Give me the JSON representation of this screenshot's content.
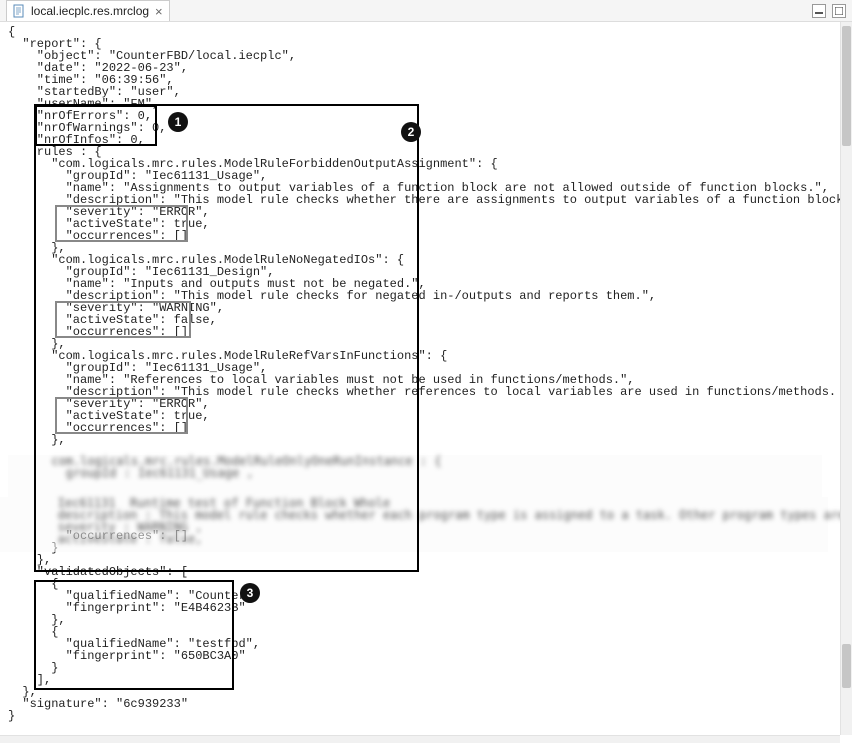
{
  "tab": {
    "title": "local.iecplc.res.mrclog",
    "close": "×"
  },
  "win": {
    "min": "▢",
    "max": "▣"
  },
  "callouts": {
    "c1": "1",
    "c2": "2",
    "c3": "3"
  },
  "report": {
    "open_brace": "{",
    "report_line": "  \"report\": {",
    "object_line": "    \"object\": \"CounterFBD/local.iecplc\",",
    "date_line": "    \"date\": \"2022-06-23\",",
    "time_line": "    \"time\": \"06:39:56\",",
    "startedBy_line": "    \"startedBy\": \"user\",",
    "userName_line": "    \"userName\": \"FM\",",
    "nrErrors": "    \"nrOfErrors\": 0,",
    "nrWarnings": "    \"nrOfWarnings\": 0,",
    "nrInfos": "    \"nrOfInfos\": 0,",
    "rules_open": "    rules : {",
    "rule1_key": "      \"com.logicals.mrc.rules.ModelRuleForbiddenOutputAssignment\": {",
    "rule1_groupId": "        \"groupId\": \"Iec61131_Usage\",",
    "rule1_name": "        \"name\": \"Assignments to output variables of a function block are not allowed outside of function blocks.\",",
    "rule1_desc": "        \"description\": \"This model rule checks whether there are assignments to output variables of a function block outside of function blocks.",
    "rule1_sev": "        \"severity\": \"ERROR\",",
    "rule1_active": "        \"activeState\": true,",
    "rule1_occ": "        \"occurrences\": []",
    "rule1_close": "      },",
    "rule2_key": "      \"com.logicals.mrc.rules.ModelRuleNoNegatedIOs\": {",
    "rule2_groupId": "        \"groupId\": \"Iec61131_Design\",",
    "rule2_name": "        \"name\": \"Inputs and outputs must not be negated.\",",
    "rule2_desc": "        \"description\": \"This model rule checks for negated in-/outputs and reports them.\",",
    "rule2_sev": "        \"severity\": \"WARNING\",",
    "rule2_active": "        \"activeState\": false,",
    "rule2_occ": "        \"occurrences\": []",
    "rule2_close": "      },",
    "rule3_key": "      \"com.logicals.mrc.rules.ModelRuleRefVarsInFunctions\": {",
    "rule3_groupId": "        \"groupId\": \"Iec61131_Usage\",",
    "rule3_name": "        \"name\": \"References to local variables must not be used in functions/methods.\",",
    "rule3_desc": "        \"description\": \"This model rule checks whether references to local variables are used in functions/methods. Such references to local var",
    "rule3_sev": "        \"severity\": \"ERROR\",",
    "rule3_active": "        \"activeState\": true,",
    "rule3_occ": "        \"occurrences\": []",
    "rule3_close": "      },",
    "blur1a": "      com.logicals.mrc.rules.ModelRuleOnlyOneRunInstance : {",
    "blur1b": "        groupId : Iec61131_Usage ,",
    "blank": "",
    "blur2a": "        Iec61131  Runtime test of Function Block Whole",
    "blur2b": "        description : This model rule checks whether each program type is assigned to a task. Other program types are reported.",
    "blur2c": "        severity : WARNING ,",
    "blur2d": "        activeState : false,",
    "rule4_occ": "        \"occurrences\": []",
    "rule4_close": "      }",
    "rules_close": "    },",
    "valObj_open": "    \"validatedObjects\": [",
    "obj1_open": "      {",
    "obj1_qname": "        \"qualifiedName\": \"Counter\",",
    "obj1_fprint": "        \"fingerprint\": \"E4B4623B\"",
    "obj1_close": "      },",
    "obj2_open": "      {",
    "obj2_qname": "        \"qualifiedName\": \"testfbd\",",
    "obj2_fprint": "        \"fingerprint\": \"650BC3A0\"",
    "obj2_close": "      }",
    "valObj_close": "    ],",
    "report_close": "  },",
    "signature": "  \"signature\": \"6c939233\"",
    "close_brace": "}"
  }
}
